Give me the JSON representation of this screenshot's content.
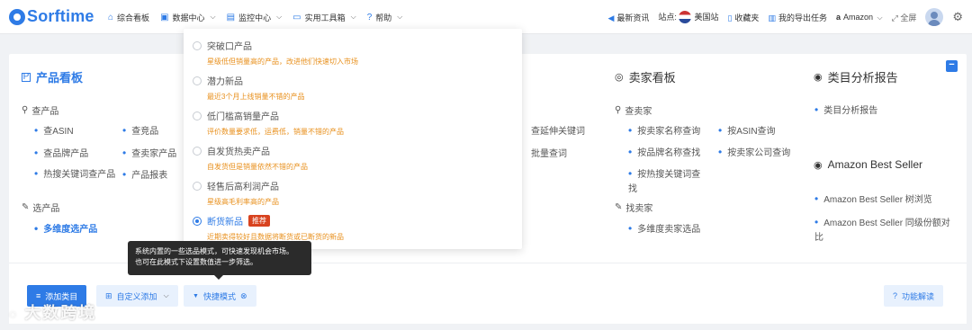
{
  "brand": {
    "name": "Sorftime"
  },
  "nav": [
    {
      "label": "综合看板",
      "icon": "home-icon",
      "chevron": false
    },
    {
      "label": "数据中心",
      "icon": "image-icon",
      "chevron": true
    },
    {
      "label": "监控中心",
      "icon": "doc-icon",
      "chevron": true
    },
    {
      "label": "实用工具箱",
      "icon": "briefcase-icon",
      "chevron": true
    },
    {
      "label": "帮助",
      "icon": "help-icon",
      "chevron": true
    }
  ],
  "right_nav": {
    "news": "最新资讯",
    "site_label": "站点:",
    "site": "美国站",
    "favorites": "收藏夹",
    "export": "我的导出任务",
    "platform": "Amazon",
    "fullscreen": "全屏"
  },
  "product_board": {
    "title": "产品看板",
    "find_products": "查产品",
    "links_col1": [
      "查ASIN",
      "查品牌产品",
      "热搜关键词查产品"
    ],
    "links_col2": [
      "查竞品",
      "查卖家产品",
      "产品报表"
    ],
    "select_products": "选产品",
    "multi_select": "多维度选产品"
  },
  "keyword_links": [
    "查延伸关键词",
    "批量查词"
  ],
  "seller_board": {
    "title": "卖家看板",
    "find_seller": "查卖家",
    "col1": [
      "按卖家名称查询",
      "按品牌名称查找",
      "按热搜关键词查找"
    ],
    "col2": [
      "按ASIN查询",
      "按卖家公司查询"
    ],
    "pick_seller": "找卖家",
    "multi": "多维度卖家选品"
  },
  "category_report": {
    "title": "类目分析报告",
    "item": "类目分析报告",
    "best_seller_title": "Amazon Best Seller",
    "best_seller_links": [
      "Amazon Best Seller 树浏览",
      "Amazon Best Seller 同级份额对比"
    ]
  },
  "footer": {
    "add_category": "添加类目",
    "custom_add": "自定义添加",
    "quick_mode": "快捷模式",
    "explain": "功能解读"
  },
  "dropdown": [
    {
      "title": "突破口产品",
      "desc": "星级低但销量高的产品，改进他们快速切入市场",
      "selected": false,
      "tag": ""
    },
    {
      "title": "潜力新品",
      "desc": "最近3个月上线销量不错的产品",
      "selected": false,
      "tag": ""
    },
    {
      "title": "低门槛高销量产品",
      "desc": "评价数量要求低，运费低，销量不错的产品",
      "selected": false,
      "tag": ""
    },
    {
      "title": "自发货热卖产品",
      "desc": "自发货但是销量依然不错的产品",
      "selected": false,
      "tag": ""
    },
    {
      "title": "轻售后高利润产品",
      "desc": "星级高毛利率高的产品",
      "selected": false,
      "tag": ""
    },
    {
      "title": "断货新品",
      "desc": "近期卖得较好且数据将断货或已断货的新品",
      "selected": true,
      "tag": "推荐"
    }
  ],
  "tooltip": {
    "line1": "系统内置的一些选品模式，可快速发现机会市场。",
    "line2": "也可在此模式下设置数值进一步筛选。"
  },
  "watermark": "大数跨境"
}
